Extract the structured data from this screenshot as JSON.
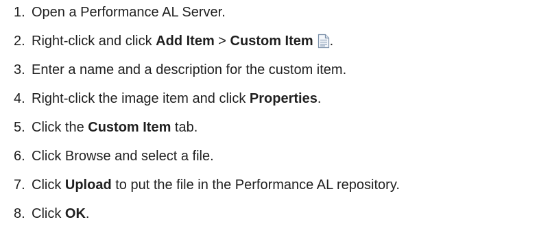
{
  "steps": [
    {
      "number": "1.",
      "text_1": "Open a Performance AL Server."
    },
    {
      "number": "2.",
      "text_1": "Right-click and click ",
      "bold_1": "Add Item",
      "text_2": " > ",
      "bold_2": "Custom Item",
      "icon": "document-icon",
      "text_3": "."
    },
    {
      "number": "3.",
      "text_1": "Enter a name and a description for the custom item."
    },
    {
      "number": "4.",
      "text_1": "Right-click the image item and click ",
      "bold_1": "Properties",
      "text_2": "."
    },
    {
      "number": "5.",
      "text_1": "Click the ",
      "bold_1": "Custom Item",
      "text_2": " tab."
    },
    {
      "number": "6.",
      "text_1": "Click Browse and select a file."
    },
    {
      "number": "7.",
      "text_1": "Click ",
      "bold_1": "Upload",
      "text_2": " to put the file in the Performance AL repository."
    },
    {
      "number": "8.",
      "text_1": "Click ",
      "bold_1": "OK",
      "text_2": "."
    }
  ]
}
